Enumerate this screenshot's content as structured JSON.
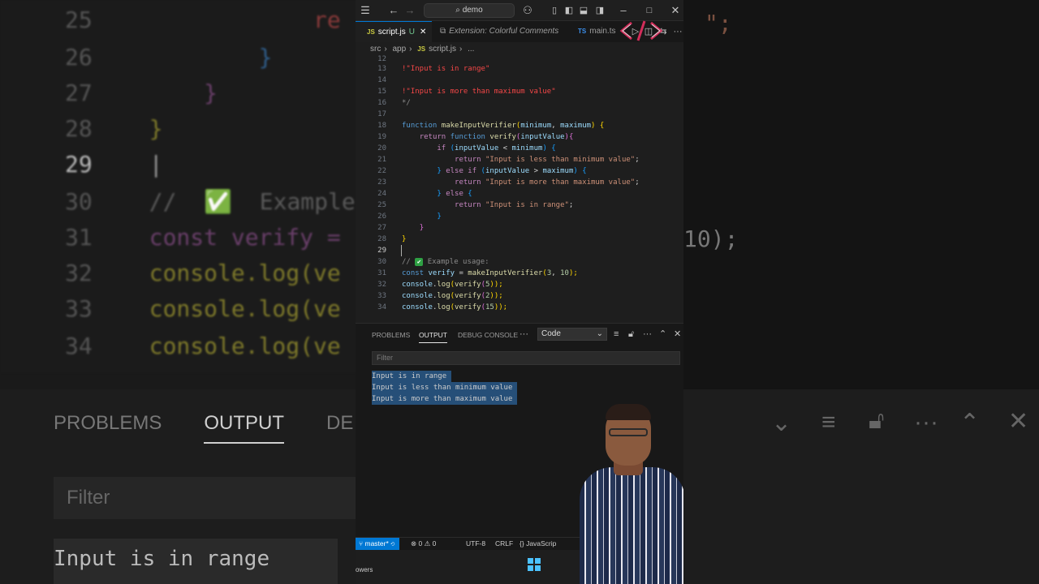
{
  "background": {
    "lines": [
      {
        "num": "25",
        "text": "              re"
      },
      {
        "num": "26",
        "text": "          }"
      },
      {
        "num": "27",
        "text": "      }"
      },
      {
        "num": "28",
        "text": "  }"
      },
      {
        "num": "29",
        "text": "  |"
      },
      {
        "num": "30",
        "text": "  //  ✅  Example"
      },
      {
        "num": "31",
        "text": "  const verify ="
      },
      {
        "num": "32",
        "text": "  console.log(ve"
      },
      {
        "num": "33",
        "text": "  console.log(ve"
      },
      {
        "num": "34",
        "text": "  console.log(ve"
      }
    ],
    "right_snippets": [
      "\";",
      "10);"
    ],
    "panel_tabs": [
      "PROBLEMS",
      "OUTPUT",
      "DE"
    ],
    "filter": "Filter",
    "output_line": "Input is in range"
  },
  "titlebar": {
    "search_label": "demo"
  },
  "tabs": [
    {
      "icon": "JS",
      "label": "script.js",
      "modified": "U",
      "active": true
    },
    {
      "icon": "",
      "label": "Extension: Colorful Comments",
      "active": false
    },
    {
      "icon": "TS",
      "label": "main.ts",
      "active": false
    }
  ],
  "breadcrumb": {
    "parts": [
      "src",
      "app",
      "script.js",
      "..."
    ]
  },
  "editor": {
    "line_numbers": [
      "12",
      "13",
      "14",
      "15",
      "16",
      "17",
      "18",
      "19",
      "20",
      "21",
      "22",
      "23",
      "24",
      "25",
      "26",
      "27",
      "28",
      "29",
      "30",
      "31",
      "32",
      "33",
      "34"
    ],
    "current_line": "29",
    "l13": "!\"Input is in range\"",
    "l15": "!\"Input is more than maximum value\"",
    "l16": "*/",
    "l18": {
      "kw": "function",
      "fn": "makeInputVerifier",
      "p1": "(",
      "a1": "minimum",
      "comma": ", ",
      "a2": "maximum",
      "p2": ")",
      "brace": " {"
    },
    "l19": {
      "kw": "return",
      "kw2": "function",
      "fn": "verify",
      "p1": "(",
      "arg": "inputValue",
      "p2": "){"
    },
    "l20": {
      "kw": "if",
      "p1": " (",
      "a": "inputValue",
      "op": " < ",
      "b": "minimum",
      "p2": ") {"
    },
    "l21": {
      "kw": "return",
      "str": "\"Input is less than minimum value\"",
      "end": ";"
    },
    "l22": {
      "pre": "} ",
      "kw": "else if",
      "p1": " (",
      "a": "inputValue",
      "op": " > ",
      "b": "maximum",
      "p2": ") {"
    },
    "l23": {
      "kw": "return",
      "str": "\"Input is more than maximum value\"",
      "end": ";"
    },
    "l24": {
      "pre": "} ",
      "kw": "else",
      "p2": " {"
    },
    "l25": {
      "kw": "return",
      "str": "\"Input is in range\"",
      "end": ";"
    },
    "l26": "}",
    "l27": "}",
    "l28": "}",
    "l30": {
      "comment": "//",
      "icon": "✔",
      "text": "Example usage:"
    },
    "l31": {
      "kw": "const",
      "v": "verify",
      "eq": " = ",
      "fn": "makeInputVerifier",
      "p1": "(",
      "n1": "3",
      "comma": ", ",
      "n2": "10",
      "p2": ");"
    },
    "l32": {
      "obj": "console",
      "dot": ".",
      "fn": "log",
      "p1": "(",
      "call": "verify",
      "p2": "(",
      "n": "5",
      "p3": "));"
    },
    "l33": {
      "obj": "console",
      "dot": ".",
      "fn": "log",
      "p1": "(",
      "call": "verify",
      "p2": "(",
      "n": "2",
      "p3": "));"
    },
    "l34": {
      "obj": "console",
      "dot": ".",
      "fn": "log",
      "p1": "(",
      "call": "verify",
      "p2": "(",
      "n": "15",
      "p3": "));"
    }
  },
  "panel": {
    "tabs": [
      "PROBLEMS",
      "OUTPUT",
      "DEBUG CONSOLE"
    ],
    "active_tab": "OUTPUT",
    "more": "···",
    "channel": "Code",
    "filter_placeholder": "Filter",
    "output": [
      "Input is in range",
      "Input is less than minimum value",
      "Input is more than maximum value"
    ]
  },
  "statusbar": {
    "branch": "master*",
    "errors": "0",
    "warnings": "0",
    "encoding": "UTF-8",
    "eol": "CRLF",
    "language": "JavaScrip"
  },
  "taskbar": {
    "label": "owers"
  }
}
